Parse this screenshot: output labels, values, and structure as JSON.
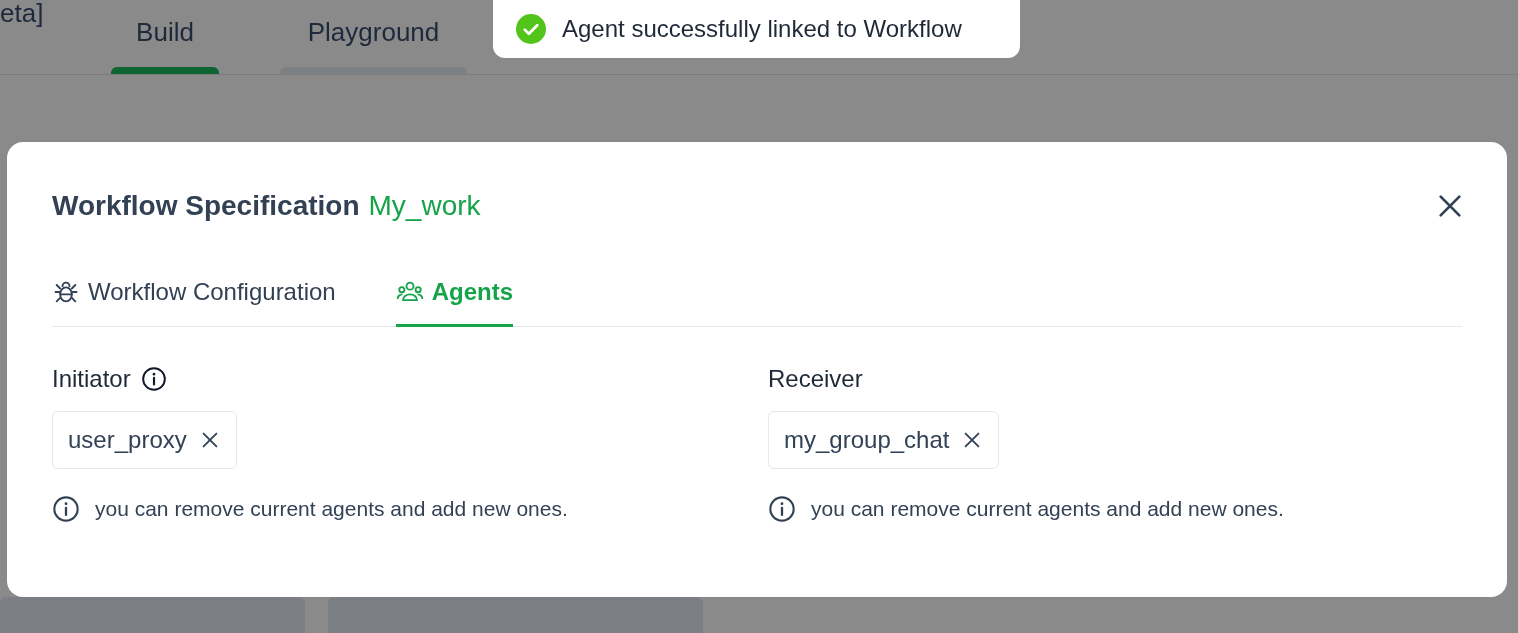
{
  "background": {
    "brand_fragment": "eta]",
    "tabs": [
      {
        "label": "Build",
        "selected": true
      },
      {
        "label": "Playground",
        "selected": false
      }
    ]
  },
  "toast": {
    "kind": "success",
    "message": "Agent successfully linked to Workflow"
  },
  "modal": {
    "title": "Workflow Specification",
    "workflow_name": "My_work",
    "tabs": [
      {
        "label": "Workflow Configuration",
        "selected": false
      },
      {
        "label": "Agents",
        "selected": true
      }
    ],
    "fields": [
      {
        "label": "Initiator",
        "info_icon": true,
        "agents": [
          "user_proxy"
        ],
        "hint": "you can remove current agents and add new ones."
      },
      {
        "label": "Receiver",
        "info_icon": false,
        "agents": [
          "my_group_chat"
        ],
        "hint": "you can remove current agents and add new ones."
      }
    ]
  }
}
